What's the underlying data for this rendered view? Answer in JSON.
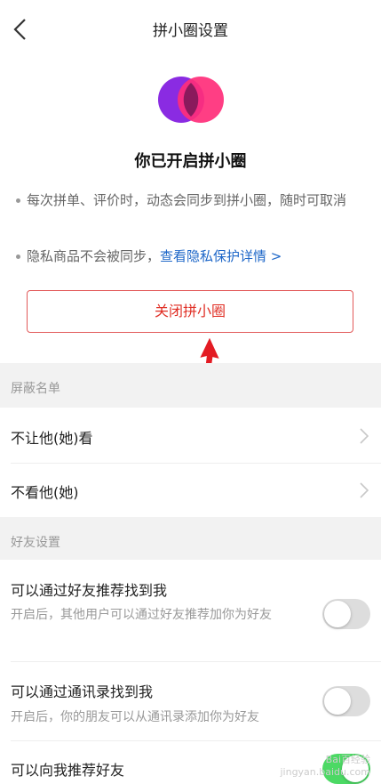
{
  "header": {
    "title": "拼小圈设置",
    "back_icon": "chevron-left-icon"
  },
  "intro": {
    "headline": "你已开启拼小圈",
    "bullet1": "每次拼单、评价时，动态会同步到拼小圈，随时可取消",
    "bullet2_text": "隐私商品不会被同步，",
    "bullet2_link": "查看隐私保护详情 >",
    "close_button": "关闭拼小圈"
  },
  "block_list": {
    "header": "屏蔽名单",
    "items": [
      {
        "label": "不让他(她)看"
      },
      {
        "label": "不看他(她)"
      }
    ]
  },
  "friend_settings": {
    "header": "好友设置",
    "items": [
      {
        "label": "可以通过好友推荐找到我",
        "desc": "开启后，其他用户可以通过好友推荐加你为好友",
        "on": false
      },
      {
        "label": "可以通过通讯录找到我",
        "desc": "开启后，你的朋友可以从通讯录添加你为好友",
        "on": false
      },
      {
        "label": "可以向我推荐好友",
        "on": true
      }
    ]
  },
  "watermark": {
    "line1": "Bai百经验",
    "line2": "jingyan.baidu.com"
  },
  "colors": {
    "accent_red": "#e02e24",
    "link_blue": "#1e67c8",
    "toggle_on": "#4cd964"
  }
}
